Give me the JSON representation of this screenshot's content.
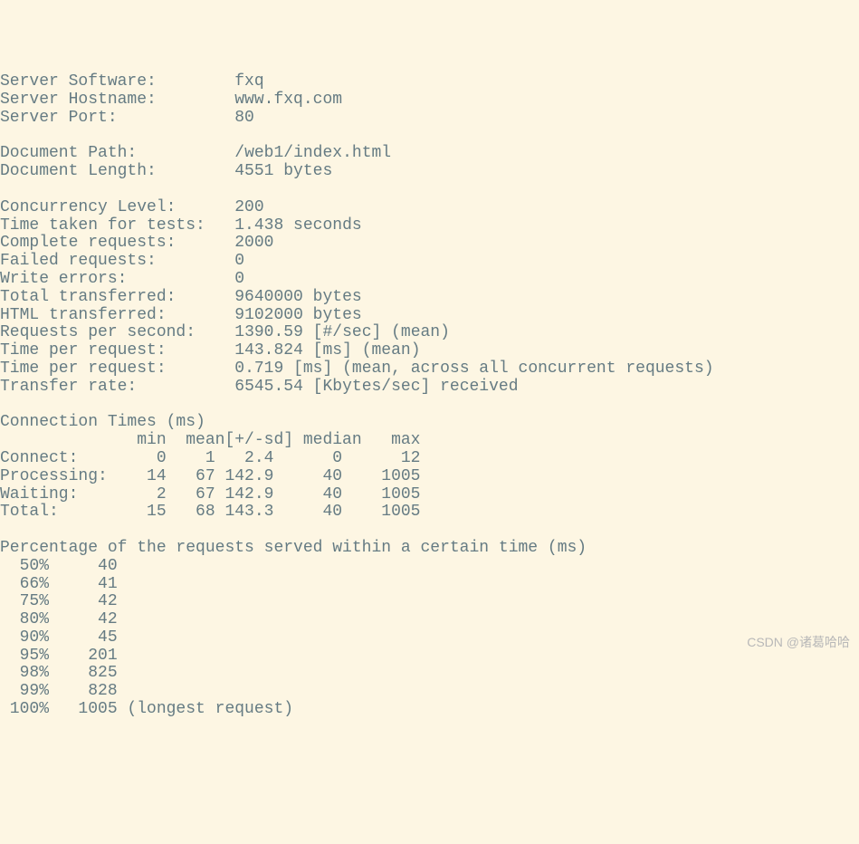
{
  "server_info": {
    "software_label": "Server Software:",
    "software_value": "fxq",
    "hostname_label": "Server Hostname:",
    "hostname_value": "www.fxq.com",
    "port_label": "Server Port:",
    "port_value": "80"
  },
  "document_info": {
    "path_label": "Document Path:",
    "path_value": "/web1/index.html",
    "length_label": "Document Length:",
    "length_value": "4551 bytes"
  },
  "test_results": {
    "concurrency_label": "Concurrency Level:",
    "concurrency_value": "200",
    "time_taken_label": "Time taken for tests:",
    "time_taken_value": "1.438 seconds",
    "complete_label": "Complete requests:",
    "complete_value": "2000",
    "failed_label": "Failed requests:",
    "failed_value": "0",
    "write_errors_label": "Write errors:",
    "write_errors_value": "0",
    "total_transferred_label": "Total transferred:",
    "total_transferred_value": "9640000 bytes",
    "html_transferred_label": "HTML transferred:",
    "html_transferred_value": "9102000 bytes",
    "rps_label": "Requests per second:",
    "rps_value": "1390.59 [#/sec] (mean)",
    "tpr1_label": "Time per request:",
    "tpr1_value": "143.824 [ms] (mean)",
    "tpr2_label": "Time per request:",
    "tpr2_value": "0.719 [ms] (mean, across all concurrent requests)",
    "transfer_rate_label": "Transfer rate:",
    "transfer_rate_value": "6545.54 [Kbytes/sec] received"
  },
  "connection_times": {
    "header": "Connection Times (ms)",
    "columns": "              min  mean[+/-sd] median   max",
    "connect": "Connect:        0    1   2.4      0      12",
    "processing": "Processing:    14   67 142.9     40    1005",
    "waiting": "Waiting:        2   67 142.9     40    1005",
    "total": "Total:         15   68 143.3     40    1005"
  },
  "percentages": {
    "header": "Percentage of the requests served within a certain time (ms)",
    "p50": "  50%     40",
    "p66": "  66%     41",
    "p75": "  75%     42",
    "p80": "  80%     42",
    "p90": "  90%     45",
    "p95": "  95%    201",
    "p98": "  98%    825",
    "p99": "  99%    828",
    "p100": " 100%   1005 (longest request)"
  },
  "watermark": "CSDN @诸葛哈哈",
  "chart_data": {
    "type": "table",
    "title": "Apache Bench Results",
    "connection_times_ms": {
      "columns": [
        "min",
        "mean",
        "+/-sd",
        "median",
        "max"
      ],
      "rows": [
        {
          "name": "Connect",
          "values": [
            0,
            1,
            2.4,
            0,
            12
          ]
        },
        {
          "name": "Processing",
          "values": [
            14,
            67,
            142.9,
            40,
            1005
          ]
        },
        {
          "name": "Waiting",
          "values": [
            2,
            67,
            142.9,
            40,
            1005
          ]
        },
        {
          "name": "Total",
          "values": [
            15,
            68,
            143.3,
            40,
            1005
          ]
        }
      ]
    },
    "percentiles": {
      "categories": [
        50,
        66,
        75,
        80,
        90,
        95,
        98,
        99,
        100
      ],
      "values": [
        40,
        41,
        42,
        42,
        45,
        201,
        825,
        828,
        1005
      ]
    }
  }
}
